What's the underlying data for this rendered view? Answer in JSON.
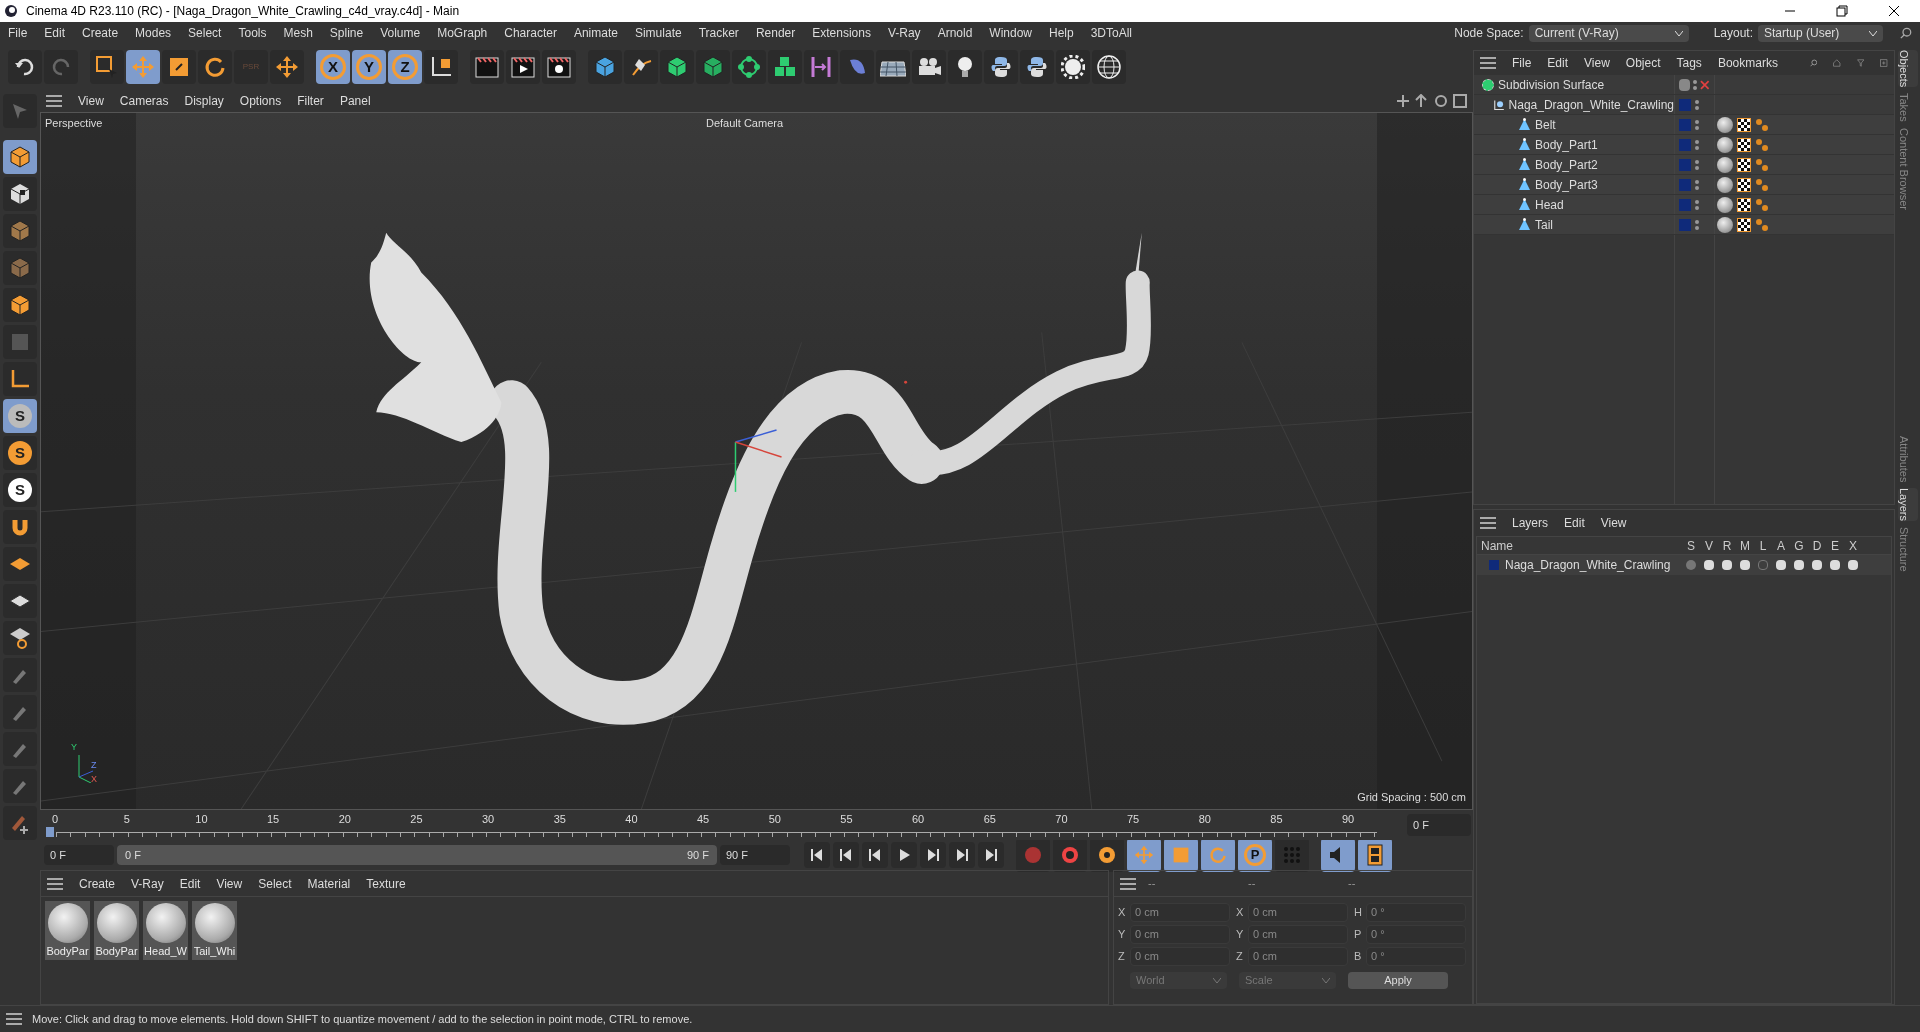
{
  "window": {
    "title": "Cinema 4D R23.110 (RC) - [Naga_Dragon_White_Crawling_c4d_vray.c4d] - Main"
  },
  "menu_bar": [
    "File",
    "Edit",
    "Create",
    "Modes",
    "Select",
    "Tools",
    "Mesh",
    "Spline",
    "Volume",
    "MoGraph",
    "Character",
    "Animate",
    "Simulate",
    "Tracker",
    "Render",
    "Extensions",
    "V-Ray",
    "Arnold",
    "Window",
    "Help",
    "3DToAll"
  ],
  "node_space": {
    "label": "Node Space:",
    "value": "Current (V-Ray)"
  },
  "layout": {
    "label": "Layout:",
    "value": "Startup (User)"
  },
  "toolbar": {
    "disabled_label": "PSR",
    "axis_buttons": [
      "X",
      "Y",
      "Z"
    ]
  },
  "left_toolbar": {
    "snap_labels": [
      "S",
      "S",
      "S"
    ]
  },
  "viewport": {
    "menu": [
      "View",
      "Cameras",
      "Display",
      "Options",
      "Filter",
      "Panel"
    ],
    "view_name": "Perspective",
    "camera": "Default Camera",
    "grid_spacing": "Grid Spacing : 500 cm",
    "axis_labels": [
      "Y",
      "Z",
      "X"
    ]
  },
  "timeline": {
    "level": 1,
    "ticks": [
      "0",
      "5",
      "10",
      "15",
      "20",
      "25",
      "30",
      "35",
      "40",
      "45",
      "50",
      "55",
      "60",
      "65",
      "70",
      "75",
      "80",
      "85",
      "90"
    ],
    "current_frame": "0 F",
    "start_field": "0 F",
    "range_start": "0 F",
    "range_end": "90 F",
    "end_field": "90 F",
    "key_label": "P"
  },
  "materials": {
    "menu": [
      "Create",
      "V-Ray",
      "Edit",
      "View",
      "Select",
      "Material",
      "Texture"
    ],
    "items": [
      "BodyPar",
      "BodyPar",
      "Head_W",
      "Tail_Whi"
    ]
  },
  "coordinates": {
    "headers": [
      "--",
      "--",
      "--"
    ],
    "rows": [
      {
        "label": "X",
        "value": "0 cm",
        "label2": "X",
        "value2": "0 cm",
        "label3": "H",
        "value3": "0 °"
      },
      {
        "label": "Y",
        "value": "0 cm",
        "label2": "Y",
        "value2": "0 cm",
        "label3": "P",
        "value3": "0 °"
      },
      {
        "label": "Z",
        "value": "0 cm",
        "label2": "Z",
        "value2": "0 cm",
        "label3": "B",
        "value3": "0 °"
      }
    ],
    "selects": [
      "World",
      "Scale"
    ],
    "apply": "Apply"
  },
  "objects_panel": {
    "menu": [
      "File",
      "Edit",
      "View",
      "Object",
      "Tags",
      "Bookmarks"
    ],
    "tree": [
      {
        "name": "Subdivision Surface",
        "kind": "generator",
        "children": [
          {
            "name": "Naga_Dragon_White_Crawling",
            "kind": "null",
            "color": "#0f2a7a",
            "children": [
              {
                "name": "Belt",
                "kind": "mesh",
                "color": "#0f2a7a"
              },
              {
                "name": "Body_Part1",
                "kind": "mesh",
                "color": "#0f2a7a"
              },
              {
                "name": "Body_Part2",
                "kind": "mesh",
                "color": "#0f2a7a"
              },
              {
                "name": "Body_Part3",
                "kind": "mesh",
                "color": "#0f2a7a"
              },
              {
                "name": "Head",
                "kind": "mesh",
                "color": "#0f2a7a"
              },
              {
                "name": "Tail",
                "kind": "mesh",
                "color": "#0f2a7a"
              }
            ]
          }
        ]
      }
    ]
  },
  "layers_panel": {
    "menu": [
      "Layers",
      "Edit",
      "View"
    ],
    "columns": [
      "Name",
      "S",
      "V",
      "R",
      "M",
      "L",
      "A",
      "G",
      "D",
      "E",
      "X"
    ],
    "rows": [
      {
        "name": "Naga_Dragon_White_Crawling",
        "color": "#0f2a7a"
      }
    ]
  },
  "side_tabs": [
    {
      "label": "Objects",
      "selected": true
    },
    {
      "label": "Takes",
      "selected": false
    },
    {
      "label": "Content Browser",
      "selected": false
    },
    {
      "label": "Attributes",
      "selected": false
    },
    {
      "label": "Layers",
      "selected": true
    },
    {
      "label": "Structure",
      "selected": false
    }
  ],
  "status_bar": "Move: Click and drag to move elements. Hold down SHIFT to quantize movement / add to the selection in point mode, CTRL to remove."
}
